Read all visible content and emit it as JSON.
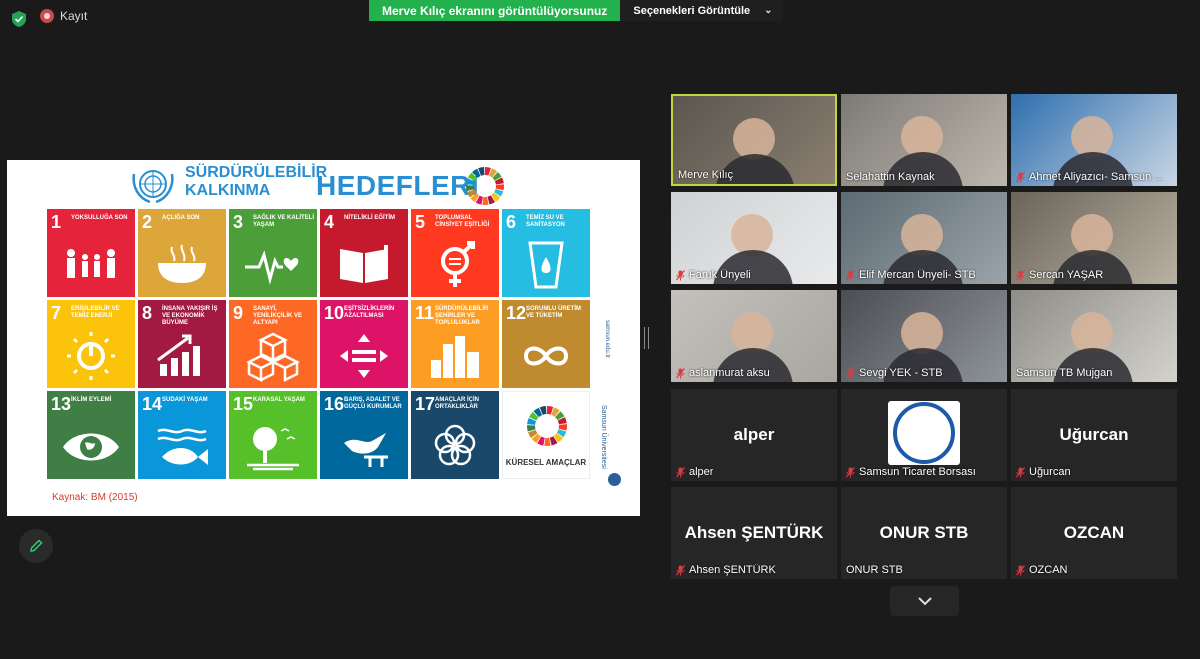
{
  "topbar": {
    "recording_label": "Kayıt",
    "share_banner": "Merve Kılıç ekranını görüntülüyorsunuz",
    "view_options": "Seçenekleri Görüntüle"
  },
  "slide": {
    "title_line1": "SÜRDÜRÜLEBİLİR",
    "title_line2": "KALKINMA",
    "title_main": "HEDEFLERİ",
    "goals": [
      {
        "num": "1",
        "label": "YOKSULLUĞA SON",
        "color": "#e5243b",
        "icon": "family-icon"
      },
      {
        "num": "2",
        "label": "AÇLIĞA SON",
        "color": "#dda63a",
        "icon": "bowl-icon"
      },
      {
        "num": "3",
        "label": "SAĞLIK VE KALİTELİ YAŞAM",
        "color": "#4c9f38",
        "icon": "heartbeat-icon"
      },
      {
        "num": "4",
        "label": "NİTELİKLİ EĞİTİM",
        "color": "#c5192d",
        "icon": "book-icon"
      },
      {
        "num": "5",
        "label": "TOPLUMSAL CİNSİYET EŞİTLİĞİ",
        "color": "#ff3a21",
        "icon": "gender-icon"
      },
      {
        "num": "6",
        "label": "TEMİZ SU VE SANİTASYON",
        "color": "#26bde2",
        "icon": "water-icon"
      },
      {
        "num": "7",
        "label": "ERİŞİLEBİLİR VE TEMİZ ENERJİ",
        "color": "#fcc30b",
        "icon": "power-icon"
      },
      {
        "num": "8",
        "label": "İNSANA YAKIŞIR İŞ VE EKONOMİK BÜYÜME",
        "color": "#a21942",
        "icon": "growth-icon"
      },
      {
        "num": "9",
        "label": "SANAYİ, YENİLİKÇİLİK VE ALTYAPI",
        "color": "#fd6925",
        "icon": "cubes-icon"
      },
      {
        "num": "10",
        "label": "EŞİTSİZLİKLERİN AZALTILMASI",
        "color": "#dd1367",
        "icon": "equal-icon"
      },
      {
        "num": "11",
        "label": "SÜRDÜRÜLEBİLİR ŞEHİRLER VE TOPLULUKLAR",
        "color": "#fd9d24",
        "icon": "city-icon"
      },
      {
        "num": "12",
        "label": "SORUMLU ÜRETİM VE TÜKETİM",
        "color": "#bf8b2e",
        "icon": "infinity-icon"
      },
      {
        "num": "13",
        "label": "İKLİM EYLEMİ",
        "color": "#3f7e44",
        "icon": "eye-globe-icon"
      },
      {
        "num": "14",
        "label": "SUDAKİ YAŞAM",
        "color": "#0a97d9",
        "icon": "fish-icon"
      },
      {
        "num": "15",
        "label": "KARASAL YAŞAM",
        "color": "#56c02b",
        "icon": "tree-icon"
      },
      {
        "num": "16",
        "label": "BARIŞ, ADALET VE GÜÇLÜ KURUMLAR",
        "color": "#00689d",
        "icon": "dove-icon"
      },
      {
        "num": "17",
        "label": "AMAÇLAR İÇİN ORTAKLIKLAR",
        "color": "#19486a",
        "icon": "rings-icon"
      }
    ],
    "global_goals_label": "KÜRESEL AMAÇLAR",
    "source": "Kaynak: BM (2015)",
    "side_url": "samsun.edu.tr",
    "side_uni": "Samsun Üniversitesi"
  },
  "participants": [
    {
      "name": "Merve Kılıç",
      "muted": false,
      "video": true,
      "active": true
    },
    {
      "name": "Selahattin Kaynak",
      "muted": false,
      "video": true
    },
    {
      "name": "Ahmet Aliyazıcı- Samsun ...",
      "muted": true,
      "video": true
    },
    {
      "name": "Faruk Ünyeli",
      "muted": true,
      "video": true
    },
    {
      "name": "Elif Mercan Ünyeli- STB",
      "muted": true,
      "video": true
    },
    {
      "name": "Sercan YAŞAR",
      "muted": true,
      "video": true
    },
    {
      "name": "aslanmurat aksu",
      "muted": true,
      "video": true
    },
    {
      "name": "Sevgi YEK - STB",
      "muted": true,
      "video": true
    },
    {
      "name": "Samsun TB Mujgan",
      "muted": false,
      "video": true
    },
    {
      "name": "alper",
      "muted": true,
      "video": false,
      "display": "alper"
    },
    {
      "name": "Samsun Ticaret Borsası",
      "muted": true,
      "video": false,
      "logo": true
    },
    {
      "name": "Uğurcan",
      "muted": true,
      "video": false,
      "display": "Uğurcan"
    },
    {
      "name": "Ahsen ŞENTÜRK",
      "muted": true,
      "video": false,
      "display": "Ahsen ŞENTÜRK"
    },
    {
      "name": "ONUR STB",
      "muted": false,
      "video": false,
      "display": "ONUR STB"
    },
    {
      "name": "OZCAN",
      "muted": true,
      "video": false,
      "display": "OZCAN"
    }
  ],
  "colors": {
    "share_green": "#22b14c",
    "active_border": "#c3d63d",
    "mic_muted": "#e0393e"
  }
}
